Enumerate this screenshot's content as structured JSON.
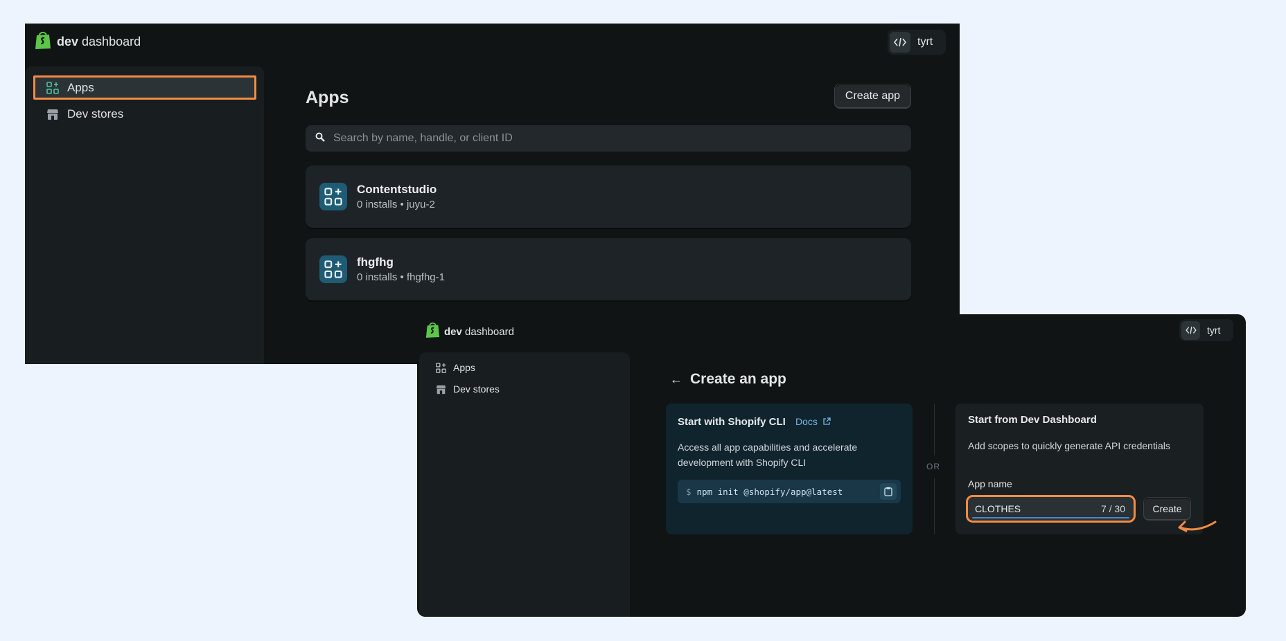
{
  "window_back": {
    "brand": {
      "bold": "dev",
      "rest": " dashboard"
    },
    "user": {
      "name": "tyrt"
    },
    "sidebar": {
      "items": [
        {
          "label": "Apps"
        },
        {
          "label": "Dev stores"
        }
      ]
    },
    "main": {
      "title": "Apps",
      "create_button": "Create app",
      "search_placeholder": "Search by name, handle, or client ID",
      "apps": [
        {
          "name": "Contentstudio",
          "meta": "0 installs • juyu-2"
        },
        {
          "name": "fhgfhg",
          "meta": "0 installs • fhgfhg-1"
        }
      ]
    }
  },
  "window_front": {
    "brand": {
      "bold": "dev",
      "rest": " dashboard"
    },
    "user": {
      "name": "tyrt"
    },
    "sidebar": {
      "items": [
        {
          "label": "Apps"
        },
        {
          "label": "Dev stores"
        }
      ]
    },
    "main": {
      "back_arrow": "←",
      "title": "Create an app",
      "cli_panel": {
        "title": "Start with Shopify CLI",
        "docs_link": "Docs",
        "description": "Access all app capabilities and accelerate development with Shopify CLI",
        "command_prompt": "$",
        "command": "npm init @shopify/app@latest"
      },
      "or_label": "OR",
      "dashboard_panel": {
        "title": "Start from Dev Dashboard",
        "description": "Add scopes to quickly generate API credentials",
        "field_label": "App name",
        "field_value": "CLOTHES",
        "char_count": "7 / 30",
        "create_button": "Create"
      }
    }
  },
  "colors": {
    "page_bg": "#eef4fe",
    "window_bg": "#101415",
    "sidebar_bg": "#181d1f",
    "highlight": "#f28c43",
    "brand_green": "#5cc64a",
    "app_icon_bg": "#1f5b74",
    "cli_panel_bg": "#10242e"
  },
  "icons": [
    "shopify-bag-icon",
    "code-icon",
    "apps-icon",
    "store-icon",
    "search-icon",
    "external-link-icon",
    "clipboard-icon",
    "back-arrow-icon"
  ]
}
